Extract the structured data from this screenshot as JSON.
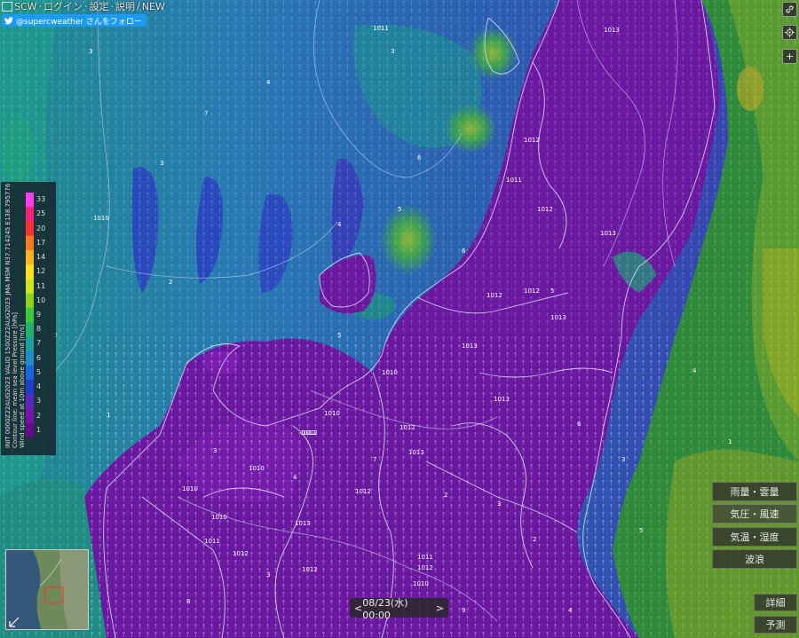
{
  "header": {
    "scw_label": "SCW",
    "separator": " · ",
    "login_label": "ログイン",
    "settings_label": "設定",
    "help_label": "説明",
    "new_label": "NEW",
    "follow_label": "@supercweather さんをフォロー"
  },
  "legend": {
    "title_line1": "INIT 0000Z22AUG2023 VALID 1500Z22AUG2023 JMA MSM N37.714245 E138.795776",
    "title_line2": "Contour line: mean sea level Pressure [hPa]",
    "title_line3": "Wind speed at 10m above ground [m/s]",
    "ticks": [
      "33",
      "25",
      "20",
      "17",
      "14",
      "12",
      "11",
      "10",
      "9",
      "8",
      "7",
      "6",
      "5",
      "4",
      "3",
      "2",
      "1"
    ],
    "colors": [
      "#ff3cf0",
      "#ff1e78",
      "#ff3030",
      "#ff7a1e",
      "#ffb41e",
      "#ffe11e",
      "#d2e61e",
      "#8cd21e",
      "#3cc83c",
      "#1eb46e",
      "#1ea0a0",
      "#1e8cc8",
      "#1e64e1",
      "#1e3ccd",
      "#5a28be",
      "#7814aa",
      "#640a8c"
    ]
  },
  "map": {
    "isobar_labels": [
      "1011",
      "1013",
      "1012",
      "1011",
      "1012",
      "1013",
      "1012",
      "1012",
      "1010",
      "1010",
      "1010",
      "1013",
      "1012",
      "1012",
      "1013",
      "1010",
      "1010",
      "1012",
      "1010",
      "1013",
      "1012",
      "1011",
      "1012",
      "1012",
      "1010",
      "1012",
      "1011",
      "1013",
      "1013"
    ],
    "wind_values": [
      "3",
      "4",
      "3",
      "5",
      "4",
      "2",
      "6",
      "5",
      "3",
      "2",
      "1",
      "3",
      "4",
      "7",
      "2",
      "6",
      "3",
      "5",
      "4",
      "1",
      "2",
      "3",
      "8",
      "9",
      "4",
      "5",
      "6",
      "7",
      "3",
      "2"
    ]
  },
  "right_controls": {
    "link_icon": "link-icon",
    "locate_icon": "target-icon",
    "zoom_in_label": "+"
  },
  "layers": {
    "rain_label": "雨量・雲量",
    "pressure_wind_label": "気圧・風速",
    "temp_humidity_label": "気温・湿度",
    "waves_label": "波浪"
  },
  "buttons": {
    "detail_label": "詳細",
    "forecast_label": "予測"
  },
  "time": {
    "prev_label": "<",
    "value": "08/23(水) 00:00",
    "next_label": ">"
  }
}
